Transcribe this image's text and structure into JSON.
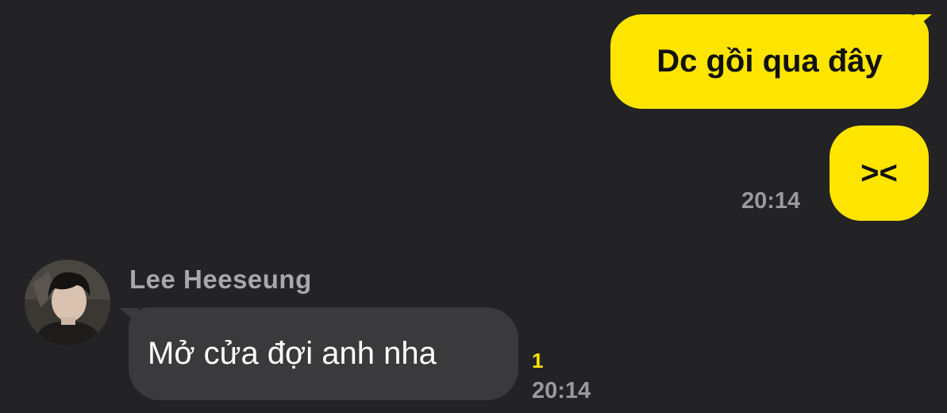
{
  "conversation": {
    "outgoing": [
      {
        "text": "Dc gồi qua đây"
      },
      {
        "text": "><",
        "time": "20:14"
      }
    ],
    "incoming": {
      "sender": "Lee Heeseung",
      "text": "Mở cửa đợi anh nha",
      "unread_count": "1",
      "time": "20:14",
      "avatar_icon": "profile-photo"
    }
  },
  "colors": {
    "background": "#232325",
    "outgoing_bubble": "#fee500",
    "incoming_bubble": "#3a3a3c",
    "timestamp": "#9a9a9c",
    "unread": "#fee500"
  }
}
